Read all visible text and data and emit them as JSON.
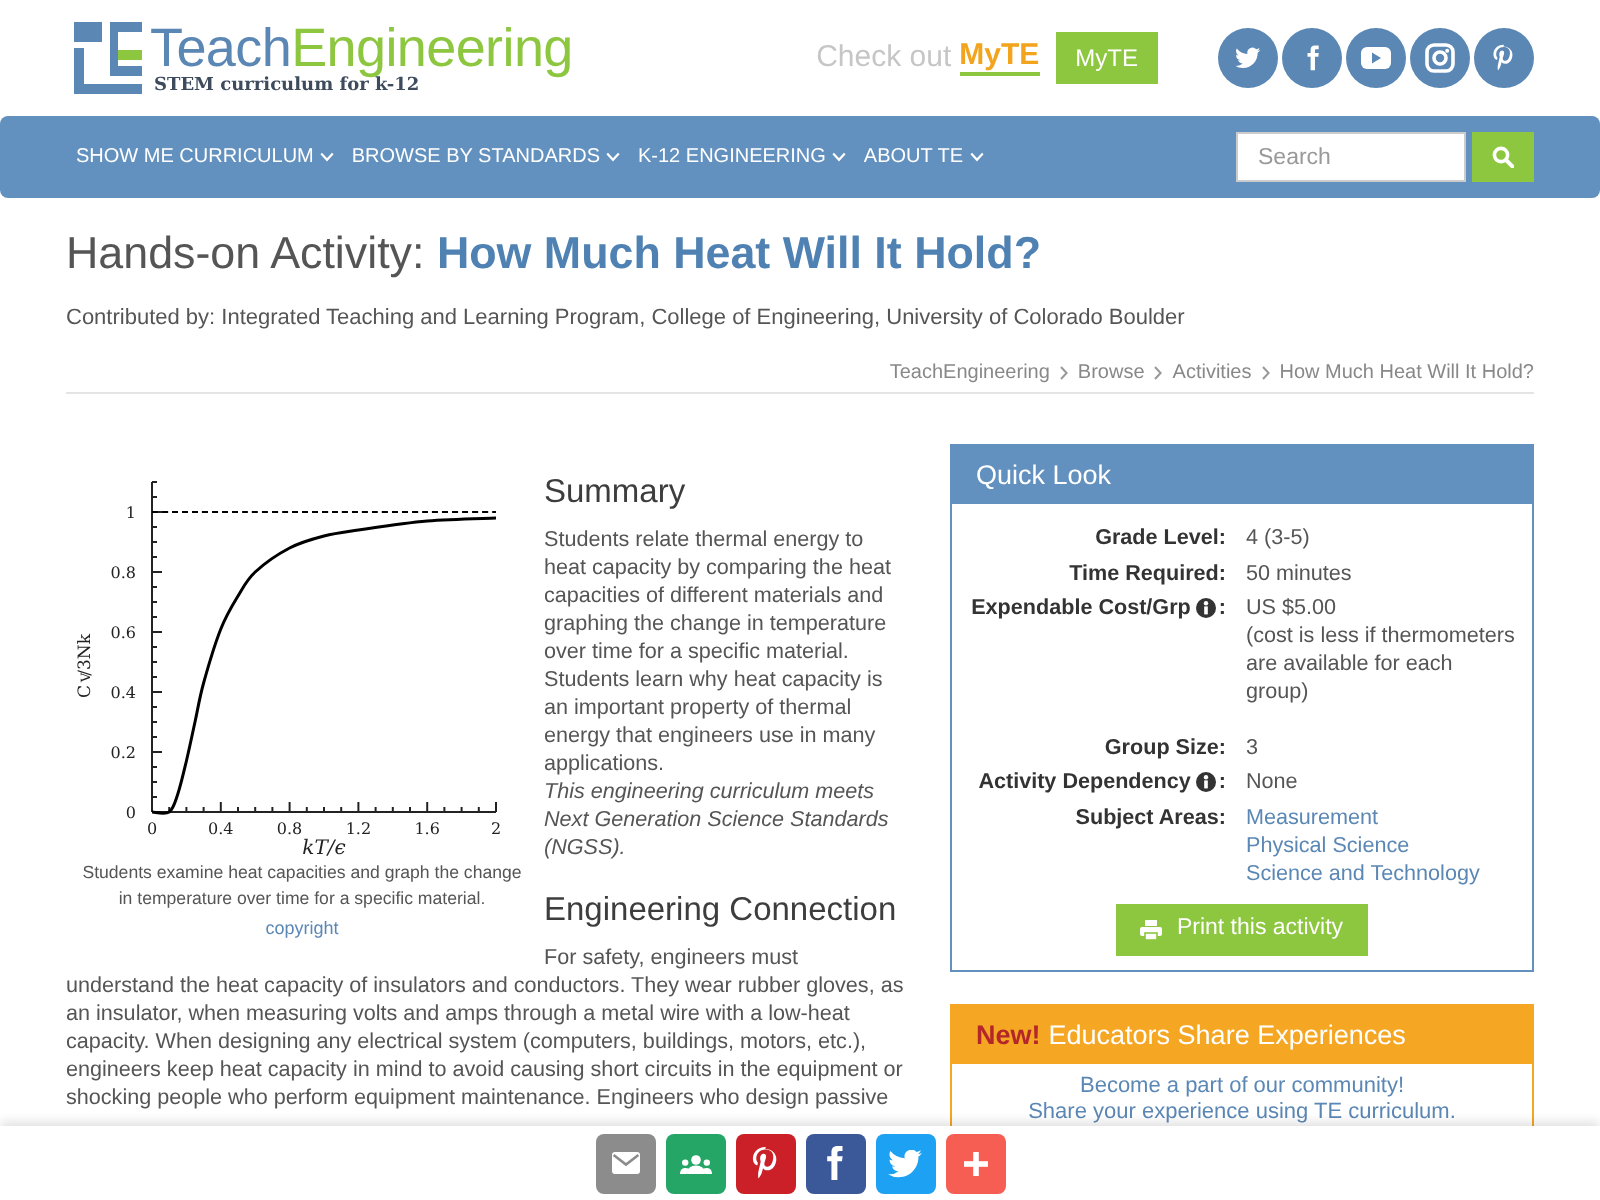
{
  "header": {
    "logo": {
      "wordmark": [
        "Teach",
        "Engineering"
      ],
      "tagline": "STEM curriculum for k-12"
    },
    "promo": {
      "text": "Check out",
      "brand": "MyTE"
    },
    "myte_button": "MyTE",
    "social": [
      {
        "kind": "twitter"
      },
      {
        "kind": "facebook"
      },
      {
        "kind": "youtube"
      },
      {
        "kind": "instagram"
      },
      {
        "kind": "pinterest"
      }
    ]
  },
  "nav": {
    "items": [
      "SHOW ME CURRICULUM",
      "BROWSE BY STANDARDS",
      "K-12 ENGINEERING",
      "ABOUT TE"
    ],
    "search": {
      "placeholder": "Search"
    }
  },
  "page_title": {
    "prefix": "Hands-on Activity:",
    "title": "How Much Heat Will It Hold?"
  },
  "contributor": "Contributed by: Integrated Teaching and Learning Program, College of Engineering, University of Colorado Boulder",
  "breadcrumb": [
    "TeachEngineering",
    "Browse",
    "Activities",
    "How Much Heat Will It Hold?"
  ],
  "figure": {
    "chart_data": {
      "type": "line",
      "xlabel": "kT/ϵ",
      "ylabel": "C$_{V}$/3Nk",
      "x": [
        0,
        0.1,
        0.15,
        0.2,
        0.25,
        0.3,
        0.4,
        0.5,
        0.6,
        0.8,
        1,
        1.2,
        1.6,
        2
      ],
      "series": [
        {
          "color": "#000000",
          "line_style": "solid",
          "values": [
            0,
            0,
            0.06,
            0.17,
            0.3,
            0.43,
            0.61,
            0.72,
            0.8,
            0.88,
            0.92,
            0.94,
            0.97,
            0.98
          ]
        },
        {
          "color": "#000000",
          "line_style": "dashed",
          "values": [
            1,
            1,
            1,
            1,
            1,
            1,
            1,
            1,
            1,
            1,
            1,
            1,
            1,
            1
          ]
        }
      ],
      "xlim": [
        0,
        2
      ],
      "ylim": [
        0,
        1.1
      ],
      "xticks": [
        0,
        0.4,
        0.8,
        1.2,
        1.6,
        2
      ],
      "yticks": [
        0,
        0.2,
        0.4,
        0.6,
        0.8,
        1
      ]
    },
    "caption": "Students examine heat capacities and graph the change in temperature over time for a specific material.",
    "credit": "copyright"
  },
  "summary": {
    "heading": "Summary",
    "text": "Students relate thermal energy to heat capacity by comparing the heat capacities of different materials and graphing the change in temperature over time for a specific material. Students learn why heat capacity is an important property of thermal energy that engineers use in many applications.",
    "note": "This engineering curriculum meets Next Generation Science Standards (NGSS)."
  },
  "engineering_connection": {
    "heading": "Engineering Connection",
    "text": "For safety, engineers must understand the heat capacity of insulators and conductors. They wear rubber gloves, as an insulator, when measuring volts and amps through a metal wire with a low-heat capacity. When designing any electrical system (computers, buildings, motors, etc.), engineers keep heat capacity in mind to avoid causing short circuits in the equipment or shocking people who perform equipment maintenance. Engineers who design passive"
  },
  "quick_look": {
    "title": "Quick Look",
    "rows": [
      {
        "label": "Grade Level:",
        "info": false,
        "kind": "text",
        "values": [
          "4 (3-5)"
        ]
      },
      {
        "label": "Time Required:",
        "info": false,
        "kind": "text",
        "values": [
          "50 minutes"
        ]
      },
      {
        "label": "Expendable Cost/Grp",
        "info": true,
        "label_end": ":",
        "kind": "text",
        "values": [
          "US $5.00",
          "(cost is less if thermometers are available for each group)"
        ]
      },
      {
        "label": "Group Size:",
        "info": false,
        "kind": "text",
        "values": [
          "3"
        ]
      },
      {
        "label": "Activity Dependency",
        "info": true,
        "label_end": ":",
        "kind": "text",
        "values": [
          "None"
        ]
      },
      {
        "label": "Subject Areas:",
        "info": false,
        "kind": "links",
        "values": [
          "Measurement",
          "Physical Science",
          "Science and Technology"
        ]
      }
    ],
    "print_button": "Print this activity"
  },
  "share_experiences": {
    "badge": "New!",
    "title": "Educators Share Experiences",
    "lines": [
      "Become a part of our community!",
      "Share your experience using TE curriculum."
    ]
  },
  "share_bar": [
    {
      "kind": "email"
    },
    {
      "kind": "classroom"
    },
    {
      "kind": "pinterest"
    },
    {
      "kind": "facebook"
    },
    {
      "kind": "twitter"
    },
    {
      "kind": "more"
    }
  ]
}
